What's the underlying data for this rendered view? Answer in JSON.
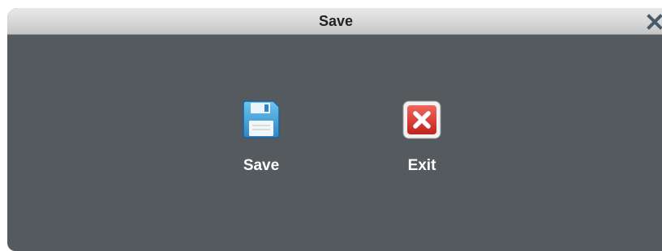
{
  "dialog": {
    "title": "Save",
    "close_icon": "close-icon"
  },
  "actions": [
    {
      "label": "Save",
      "icon": "floppy-disk-icon",
      "accent": "#4aa8dc"
    },
    {
      "label": "Exit",
      "icon": "red-x-icon",
      "accent": "#d9302a"
    }
  ],
  "colors": {
    "panel": "#545a5e",
    "titlebar": "#d7d7d7"
  }
}
